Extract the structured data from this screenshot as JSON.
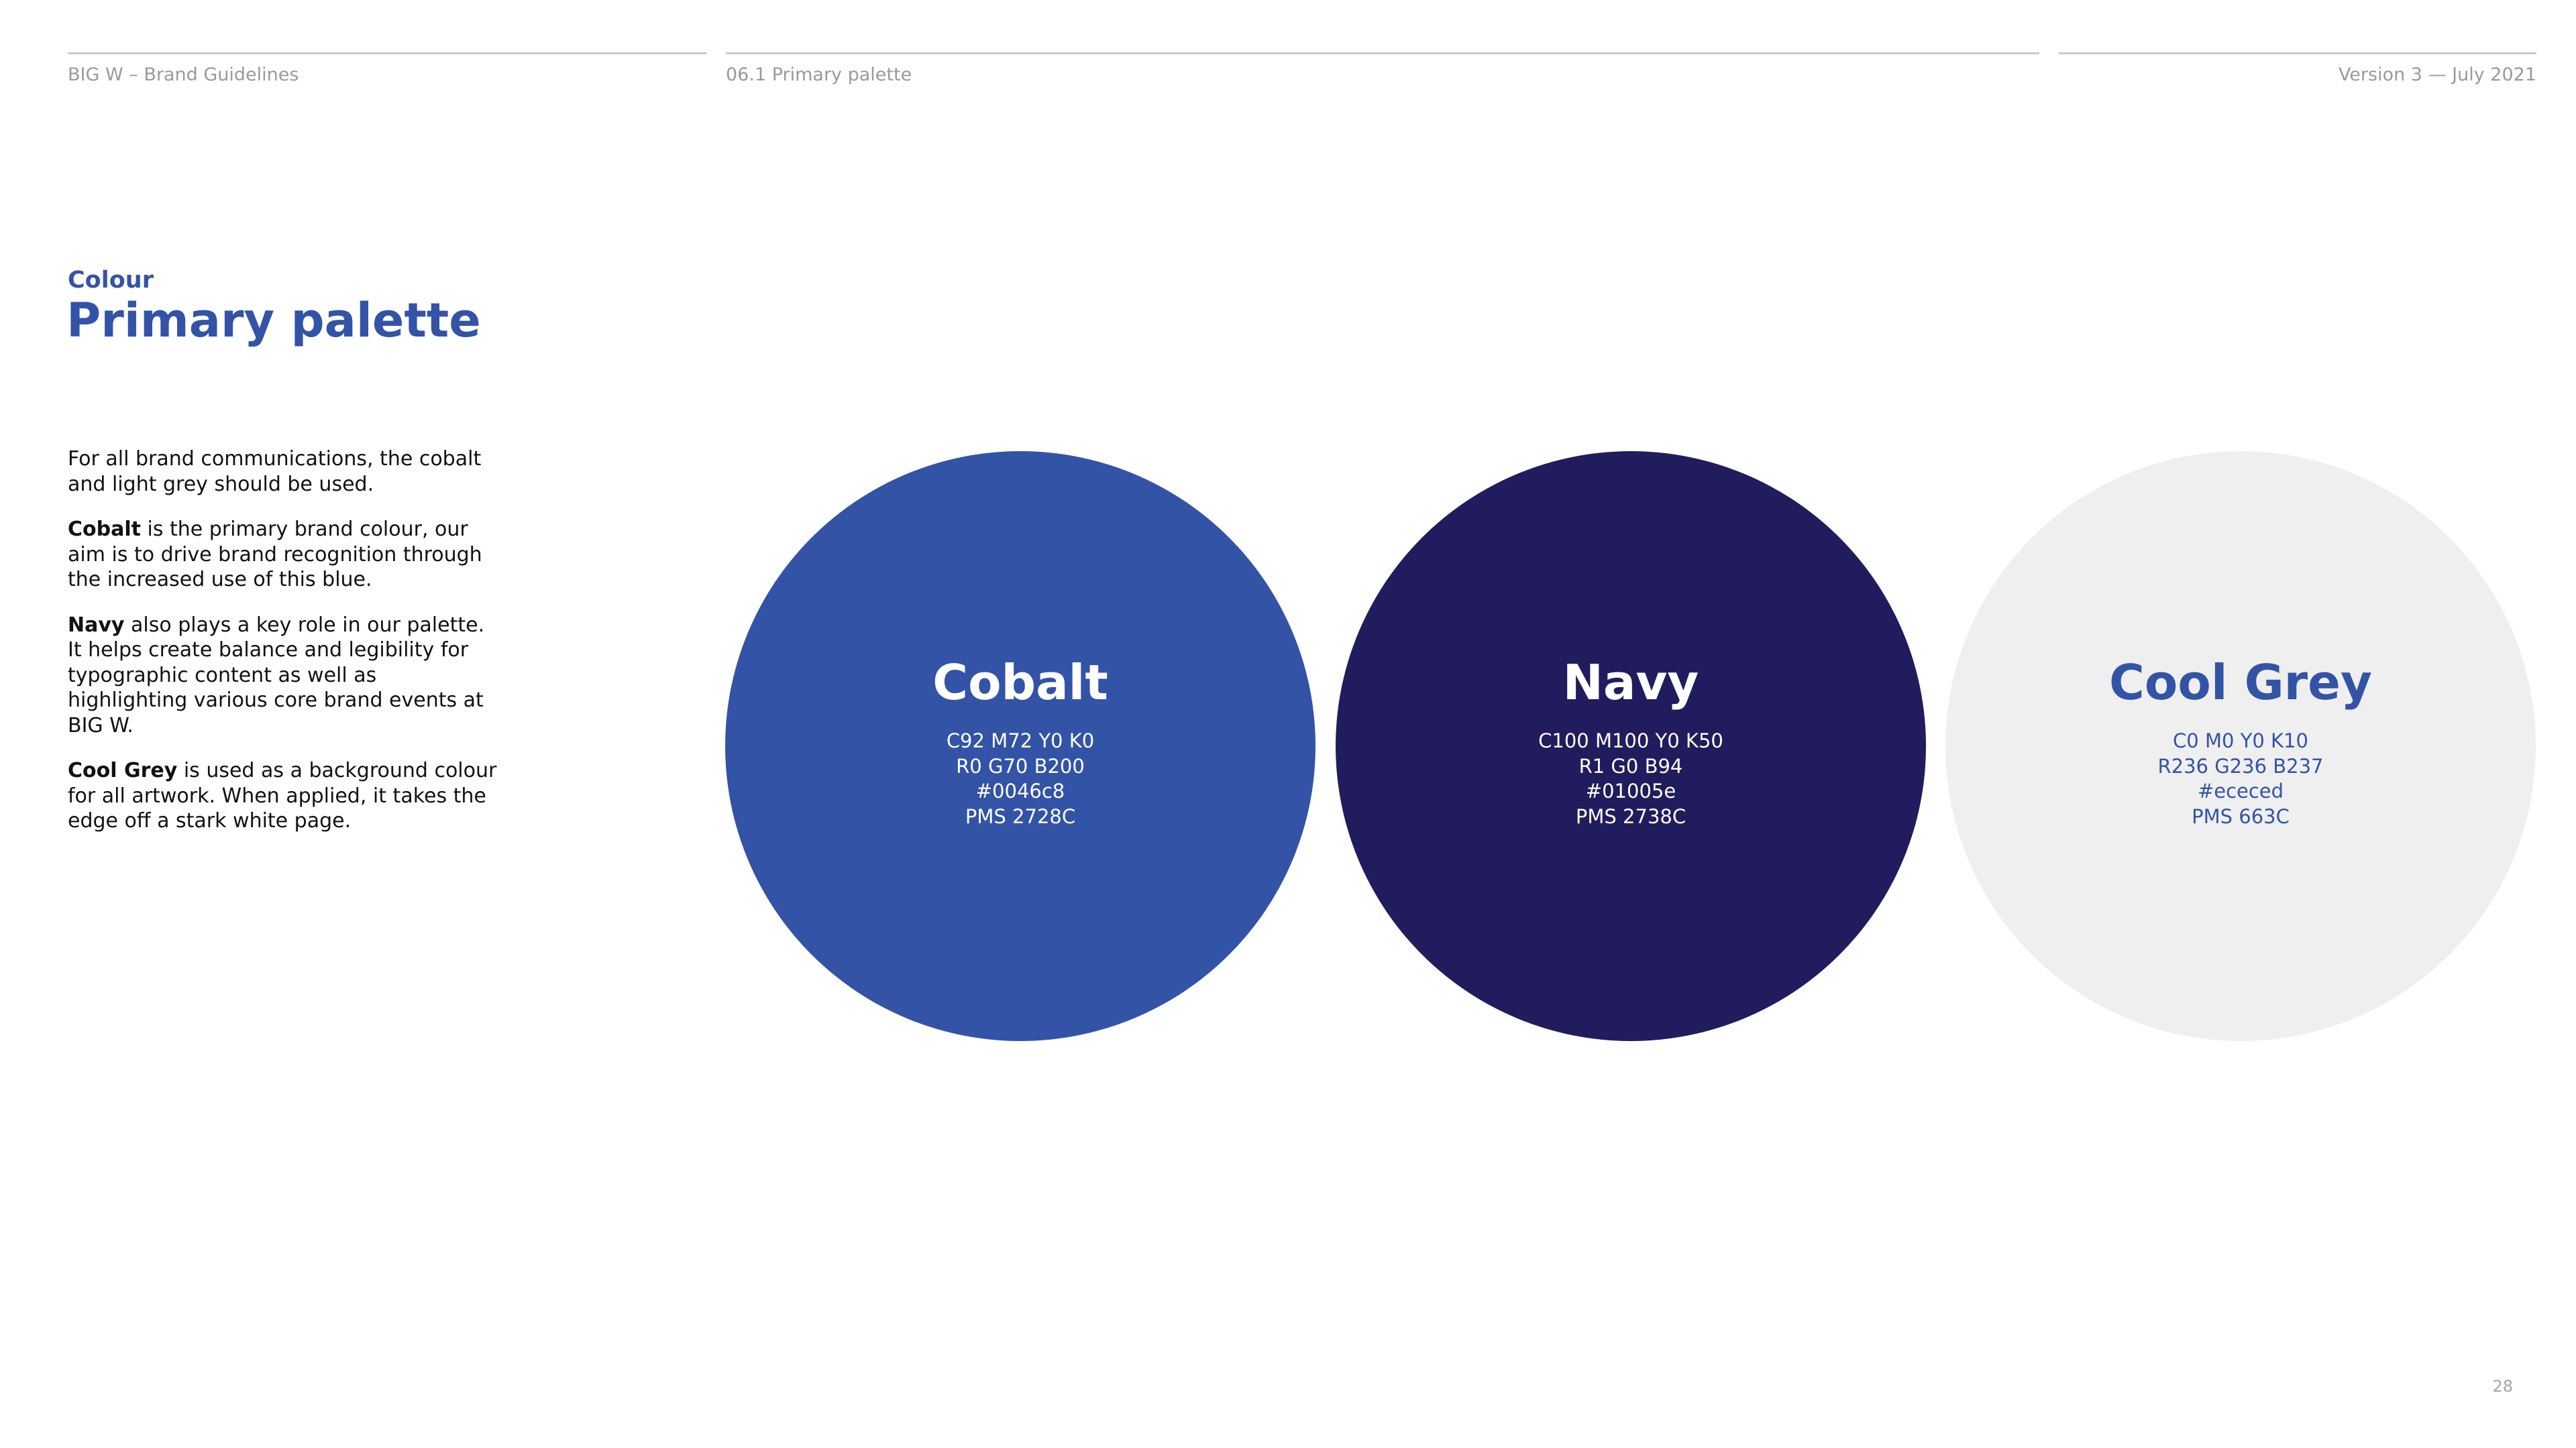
{
  "header": {
    "left": "BIG W – Brand Guidelines",
    "center": "06.1 Primary palette",
    "right": "Version 3 — July 2021"
  },
  "section": {
    "eyebrow": "Colour",
    "title": "Primary palette"
  },
  "body": {
    "intro": "For all brand communications, the cobalt and light grey should be used.",
    "cobalt_bold": "Cobalt",
    "cobalt_text": " is the primary brand colour, our aim is to drive brand recognition through the increased use of this blue.",
    "navy_bold": "Navy",
    "navy_text": " also plays a key role in our palette. It helps create balance and legibility for typographic content as well as highlighting various core brand events at BIG W.",
    "grey_bold": "Cool Grey",
    "grey_text": " is used as a background colour for all artwork. When applied, it takes the edge off a stark white page."
  },
  "swatches": [
    {
      "name": "Cobalt",
      "cmyk": "C92 M72 Y0 K0",
      "rgb": "R0 G70 B200",
      "hex": "#0046c8",
      "pms": "PMS 2728C",
      "fill": "#3353a6",
      "text_color": "#ffffff"
    },
    {
      "name": "Navy",
      "cmyk": "C100 M100 Y0 K50",
      "rgb": "R1 G0 B94",
      "hex": "#01005e",
      "pms": "PMS 2738C",
      "fill": "#211c5d",
      "text_color": "#ffffff"
    },
    {
      "name": "Cool Grey",
      "cmyk": "C0 M0 Y0 K10",
      "rgb": "R236 G236 B237",
      "hex": "#ececed",
      "pms": "PMS 663C",
      "fill": "#efefef",
      "text_color": "#3353a6"
    }
  ],
  "page_number": "28"
}
